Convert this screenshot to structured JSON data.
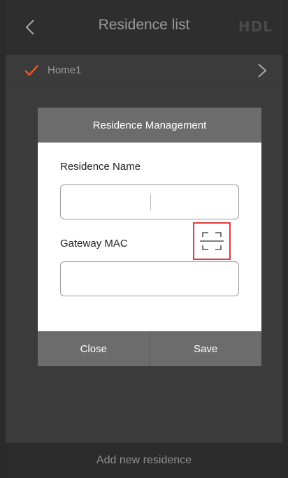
{
  "header": {
    "title": "Residence list",
    "brand": "HDL",
    "back_icon": "chevron-left-icon"
  },
  "list": {
    "items": [
      {
        "label": "Home1",
        "selected": true,
        "check_icon": "checkmark-icon",
        "chevron_icon": "chevron-right-icon"
      }
    ]
  },
  "dialog": {
    "title": "Residence Management",
    "name_label": "Residence Name",
    "name_value": "",
    "mac_label": "Gateway MAC",
    "mac_value": "",
    "scan_icon": "qr-scan-icon",
    "close_label": "Close",
    "save_label": "Save"
  },
  "footer": {
    "add_label": "Add new residence"
  },
  "colors": {
    "accent": "#e8572a",
    "highlight": "#e23b3b",
    "dialog_bar": "#6c6c6c",
    "background": "#3b3b3b"
  }
}
